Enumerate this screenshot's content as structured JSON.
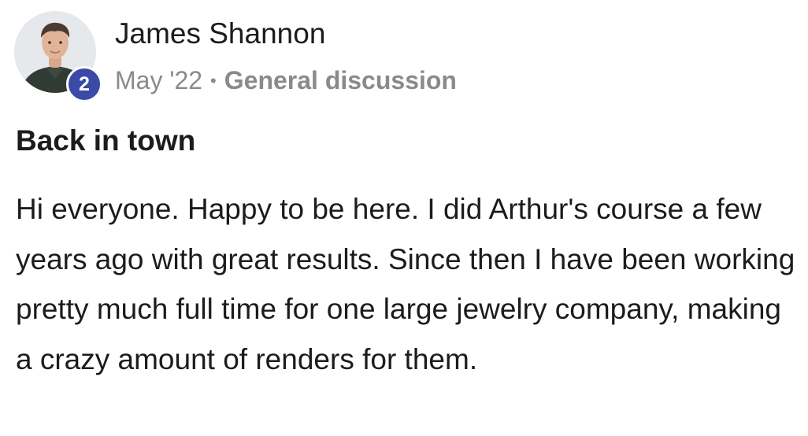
{
  "post": {
    "author": {
      "name": "James Shannon",
      "level": "2"
    },
    "meta": {
      "date": "May '22",
      "separator": "•",
      "category": "General discussion"
    },
    "title": "Back in town",
    "body": "Hi everyone. Happy to be here. I did Arthur's course a few years ago with great results. Since then I have been working pretty much full time for one large jewelry company, making a crazy amount of renders for them."
  },
  "colors": {
    "badge": "#3a4aa6",
    "meta_text": "#8a8a8a",
    "body_text": "#1c1c1c"
  }
}
